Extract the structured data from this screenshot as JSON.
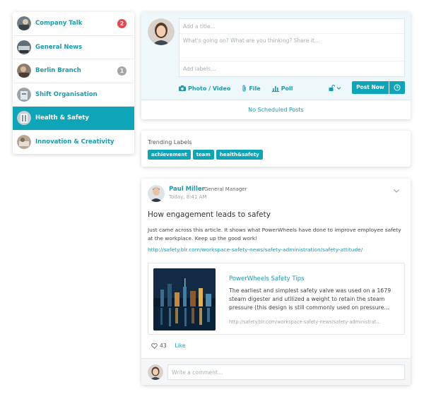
{
  "sidebar": {
    "items": [
      {
        "label": "Company Talk",
        "badge": "2",
        "badge_color": "#e8474e",
        "avatar_color": "#6d7f86"
      },
      {
        "label": "General News",
        "badge": "",
        "avatar_color": "#5f6f75"
      },
      {
        "label": "Berlin Branch",
        "badge": "1",
        "badge_color": "#a6a6a6",
        "avatar_color": "#8a7d6e"
      },
      {
        "label": "Shift Organisation",
        "badge": "",
        "avatar_color": "#9aa3a8"
      },
      {
        "label": "Health & Safety",
        "badge": "",
        "avatar_color": "#c9cfd2",
        "active": true
      },
      {
        "label": "Innovation & Creativity",
        "badge": "",
        "avatar_color": "#b7a692"
      }
    ]
  },
  "composer": {
    "title_placeholder": "Add a title…",
    "body_placeholder": "What's going on? What are you thinking? Share it…",
    "labels_placeholder": "Add labels…",
    "actions": [
      {
        "label": "Photo / Video",
        "icon": "camera-icon"
      },
      {
        "label": "File",
        "icon": "paperclip-icon"
      },
      {
        "label": "Poll",
        "icon": "bar-chart-icon"
      }
    ],
    "privacy_icon": "unlock-icon",
    "post_button": "Post Now",
    "schedule_icon": "clock-icon",
    "scheduled_link": "No Scheduled Posts"
  },
  "trending": {
    "title": "Trending Labels",
    "tags": [
      "achievement",
      "team",
      "health&safety"
    ]
  },
  "post": {
    "author": "Paul Miller",
    "role": "General Manager",
    "time": "Today, 8:41 AM",
    "title": "How engagement leads to safety",
    "body": "Just came across this article. It shows what PowerWheels have done to improve employee safety at the workplace. Keep up the good work!",
    "url": "http://safety.blr.com/workspace-safety-news/safety-administration/safety-attitude/",
    "link_card": {
      "title": "PowerWheels Safety Tips",
      "description": "The earliest and simplest safety valve was used on a 1679 steam digester and utilized a weight to retain the steam pressure (this design is still commonly used on pressure…",
      "url": "http://safety.blr.com/workspace-safety-news/safety-administrat…"
    },
    "like_count": "43",
    "like_label": "Like",
    "comment_placeholder": "Write a comment…"
  },
  "colors": {
    "accent": "#0ea5b8",
    "link": "#1a9bb0"
  }
}
